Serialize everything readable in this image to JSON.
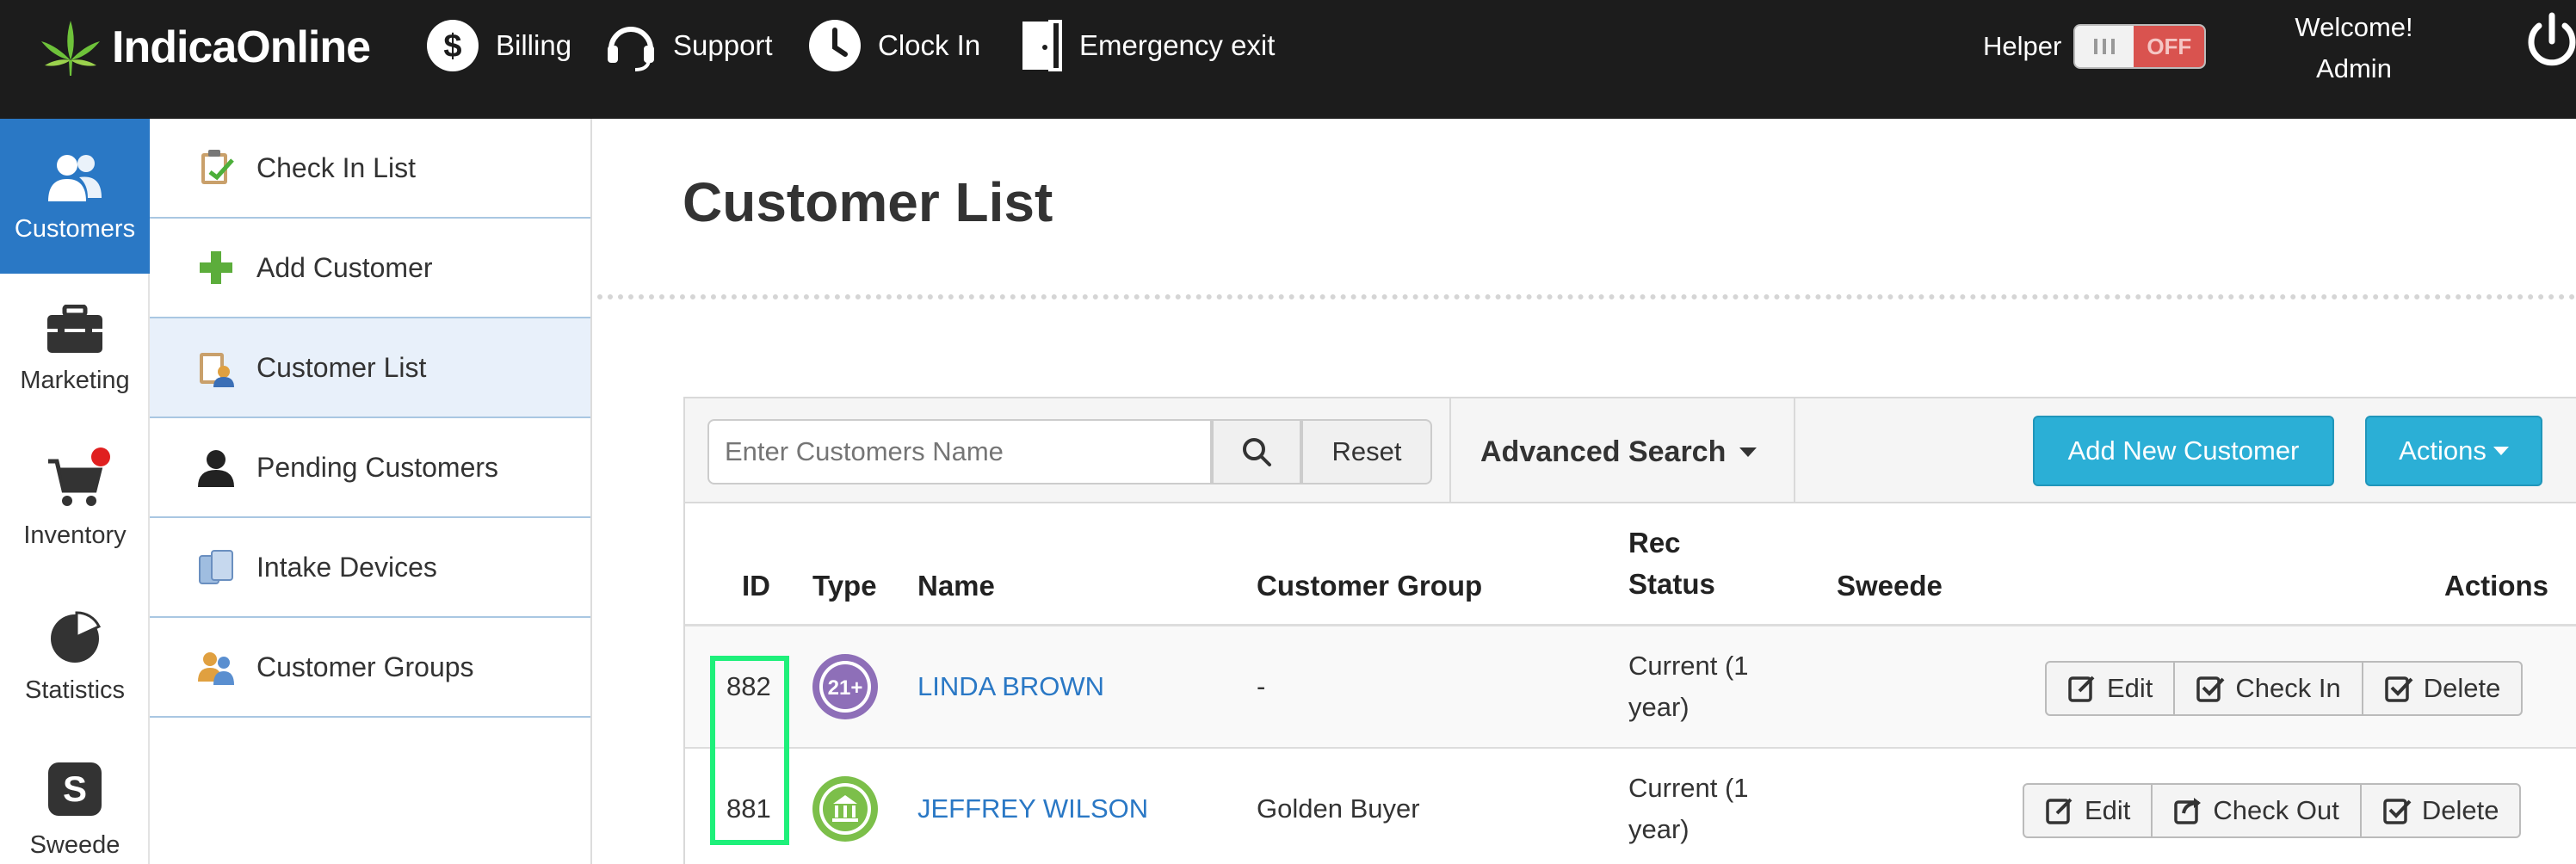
{
  "app": {
    "name": "IndicaOnline"
  },
  "topnav": {
    "billing": "Billing",
    "support": "Support",
    "clock_in": "Clock In",
    "emergency_exit": "Emergency exit"
  },
  "helper": {
    "label": "Helper",
    "state": "OFF"
  },
  "user": {
    "welcome": "Welcome!",
    "name": "Admin"
  },
  "rail": [
    {
      "label": "Customers",
      "icon": "users-icon",
      "active": true
    },
    {
      "label": "Marketing",
      "icon": "briefcase-icon"
    },
    {
      "label": "Inventory",
      "icon": "cart-icon",
      "notification_dot": true
    },
    {
      "label": "Statistics",
      "icon": "pie-chart-icon"
    },
    {
      "label": "Sweede",
      "icon": "sweede-icon"
    }
  ],
  "submenu": [
    {
      "label": "Check In List",
      "icon": "clipboard-check-icon"
    },
    {
      "label": "Add Customer",
      "icon": "plus-icon"
    },
    {
      "label": "Customer List",
      "icon": "customer-list-icon",
      "active": true
    },
    {
      "label": "Pending Customers",
      "icon": "person-icon"
    },
    {
      "label": "Intake Devices",
      "icon": "devices-icon"
    },
    {
      "label": "Customer Groups",
      "icon": "group-icon"
    }
  ],
  "page": {
    "title": "Customer List"
  },
  "toolbar": {
    "search_placeholder": "Enter Customers Name",
    "reset": "Reset",
    "advanced_search": "Advanced Search",
    "add_new_customer": "Add New Customer",
    "actions": "Actions"
  },
  "table": {
    "headers": {
      "id": "ID",
      "type": "Type",
      "name": "Name",
      "group": "Customer Group",
      "rec_status_1": "Rec",
      "rec_status_2": "Status",
      "sweede": "Sweede",
      "actions": "Actions"
    },
    "rows": [
      {
        "id": "882",
        "type": "21+",
        "name": "LINDA BROWN",
        "group": "-",
        "rec_status_1": "Current (1",
        "rec_status_2": "year)",
        "sweede": "",
        "buttons": [
          "Edit",
          "Check In",
          "Delete"
        ]
      },
      {
        "id": "881",
        "type": "state-medical",
        "name": "JEFFREY WILSON",
        "group": "Golden Buyer",
        "rec_status_1": "Current (1",
        "rec_status_2": "year)",
        "sweede": "",
        "buttons": [
          "Edit",
          "Check Out",
          "Delete"
        ]
      }
    ]
  },
  "colors": {
    "topbar": "#1c1c1c",
    "accent": "#2a78c5",
    "button": "#2bafd6",
    "highlight": "#1ef07a"
  }
}
